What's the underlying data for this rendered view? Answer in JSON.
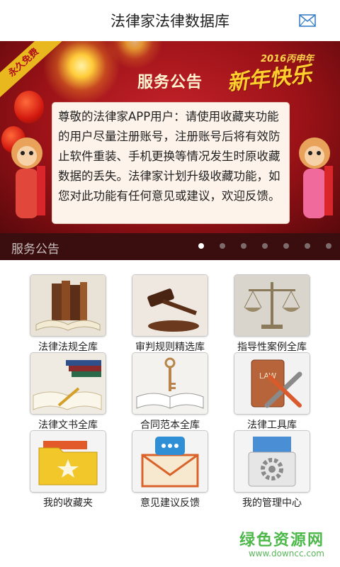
{
  "header": {
    "title": "法律家法律数据库",
    "mail_icon": "mail-icon"
  },
  "banner": {
    "ribbon": "永久免费",
    "title": "服务公告",
    "year_text": "2016丙申年",
    "greeting": "新年快乐",
    "notice": "尊敬的法律家APP用户：请使用收藏夹功能的用户尽量注册账号，注册账号后将有效防止软件重装、手机更换等情况发生时原收藏数据的丢失。法律家计划升级收藏功能，如您对此功能有任何意见或建议，欢迎反馈。",
    "caption": "服务公告",
    "dots_total": 7,
    "active_dot": 1
  },
  "tiles": [
    {
      "label": "法律法规全库",
      "icon": "books-icon"
    },
    {
      "label": "审判规则精选库",
      "icon": "gavel-icon"
    },
    {
      "label": "指导性案例全库",
      "icon": "scales-icon"
    },
    {
      "label": "法律文书全库",
      "icon": "open-book-pen-icon"
    },
    {
      "label": "合同范本全库",
      "icon": "key-book-icon"
    },
    {
      "label": "法律工具库",
      "icon": "law-tools-icon"
    },
    {
      "label": "我的收藏夹",
      "icon": "star-folder-icon"
    },
    {
      "label": "意见建议反馈",
      "icon": "chat-envelope-icon"
    },
    {
      "label": "我的管理中心",
      "icon": "gear-box-icon"
    }
  ],
  "watermark": {
    "line1": "绿色资源网",
    "line2": "www.downcc.com"
  },
  "colors": {
    "banner_red": "#9b1217",
    "caption_bar": "#3a0d0e",
    "notice_bg": "#fdf3ea",
    "watermark_green": "#4db84a"
  }
}
